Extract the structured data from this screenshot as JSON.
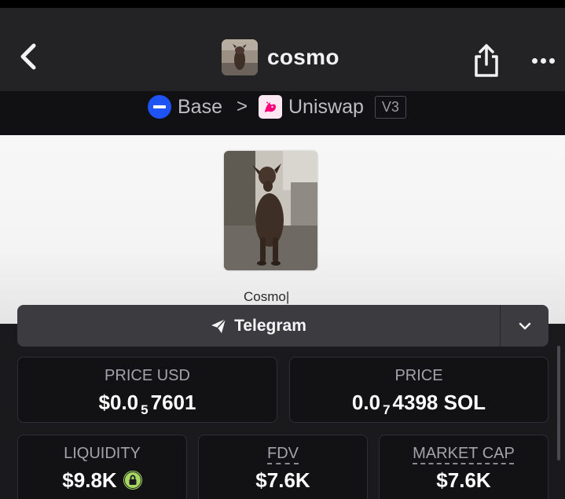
{
  "header": {
    "title": "cosmo",
    "back_icon": "chevron-left-icon",
    "share_icon": "share-icon",
    "more_icon": "more-horizontal-icon"
  },
  "chain": {
    "network": "Base",
    "separator": ">",
    "dex": "Uniswap",
    "version": "V3"
  },
  "banner": {
    "caption": "Cosmo|"
  },
  "social": {
    "telegram_label": "Telegram",
    "telegram_icon": "paper-plane-icon",
    "dropdown_icon": "chevron-down-icon"
  },
  "stats": {
    "price_usd_label": "PRICE USD",
    "price_usd_prefix": "$0.0",
    "price_usd_zeros": "5",
    "price_usd_digits": "7601",
    "price_label": "PRICE",
    "price_prefix": "0.0",
    "price_zeros": "7",
    "price_digits": "4398 SOL",
    "liquidity_label": "LIQUIDITY",
    "liquidity_value": "$9.8K",
    "liquidity_lock_icon": "lock-icon",
    "fdv_label": "FDV",
    "fdv_value": "$7.6K",
    "market_cap_label": "MARKET CAP",
    "market_cap_value": "$7.6K"
  },
  "colors": {
    "background": "#1a1a1d",
    "header": "#232326",
    "base_blue": "#1e54f5",
    "uniswap_pink": "#ff007a",
    "lock_green": "#a7d864"
  }
}
